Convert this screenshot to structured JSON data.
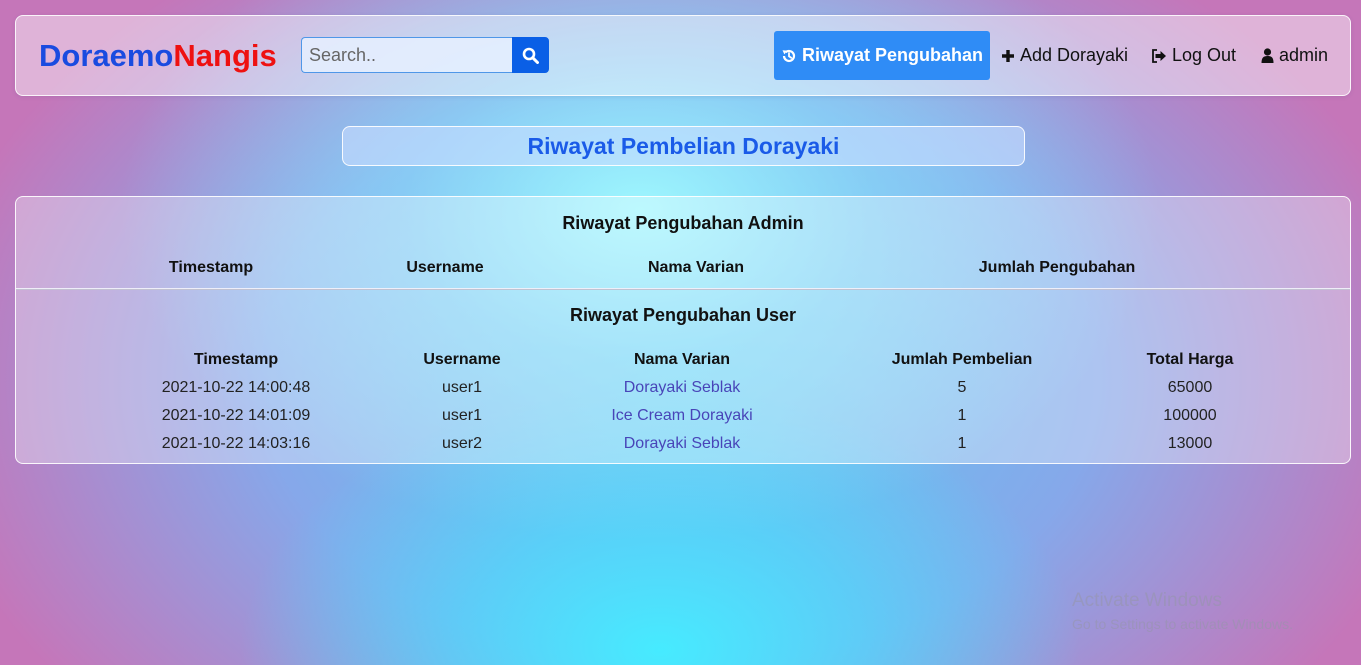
{
  "brand": {
    "part1": "Doraemo",
    "part2": "Nangis"
  },
  "search": {
    "placeholder": "Search.."
  },
  "nav": {
    "history": "Riwayat Pengubahan",
    "add": "Add Dorayaki",
    "logout": "Log Out",
    "user": "admin"
  },
  "page_title": "Riwayat Pembelian Dorayaki",
  "admin_history": {
    "title": "Riwayat Pengubahan Admin",
    "columns": [
      "Timestamp",
      "Username",
      "Nama Varian",
      "Jumlah Pengubahan"
    ],
    "rows": []
  },
  "user_history": {
    "title": "Riwayat Pengubahan User",
    "columns": [
      "Timestamp",
      "Username",
      "Nama Varian",
      "Jumlah Pembelian",
      "Total Harga"
    ],
    "rows": [
      [
        "2021-10-22 14:00:48",
        "user1",
        "Dorayaki Seblak",
        "5",
        "65000"
      ],
      [
        "2021-10-22 14:01:09",
        "user1",
        "Ice Cream Dorayaki",
        "1",
        "100000"
      ],
      [
        "2021-10-22 14:03:16",
        "user2",
        "Dorayaki Seblak",
        "1",
        "13000"
      ]
    ]
  },
  "watermark": {
    "line1": "Activate Windows",
    "line2": "Go to Settings to activate Windows."
  },
  "colors": {
    "accent": "#2f8cf6",
    "brand_blue": "#1a4be0",
    "brand_red": "#ee1111",
    "link": "#4845b8"
  }
}
